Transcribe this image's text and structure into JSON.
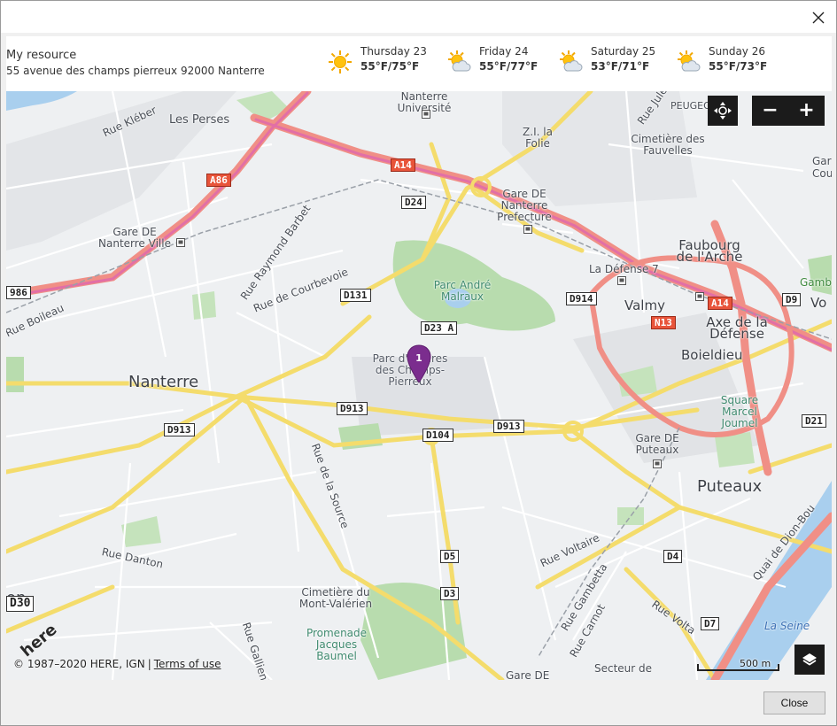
{
  "dialog": {
    "close_icon": "close-x-icon",
    "close_button_label": "Close"
  },
  "resource": {
    "name": "My resource",
    "address": "55 avenue des champs pierreux 92000 Nanterre"
  },
  "weather": [
    {
      "day": "Thursday 23",
      "temp": "55°F/75°F",
      "icon": "sunny-icon"
    },
    {
      "day": "Friday 24",
      "temp": "55°F/77°F",
      "icon": "partly-cloudy-icon"
    },
    {
      "day": "Saturday 25",
      "temp": "53°F/71°F",
      "icon": "partly-cloudy-icon"
    },
    {
      "day": "Sunday 26",
      "temp": "55°F/73°F",
      "icon": "partly-cloudy-icon"
    }
  ],
  "map": {
    "marker_label": "1",
    "controls": {
      "pan_icon": "pan-move-icon",
      "zoom_out": "−",
      "zoom_in": "+",
      "layers_icon": "layers-icon"
    },
    "copyright": "© 1987–2020 HERE, IGN",
    "separator": "|",
    "terms_link": "Terms of use",
    "scale_label": "500 m",
    "logo": "here",
    "places": {
      "nanterre": "Nanterre",
      "puteaux": "Puteaux",
      "faubourg": "Faubourg de l'Arche",
      "axe": "Axe de la Défense",
      "boieldieu": "Boieldieu",
      "valmy": "Valmy",
      "les_perses": "Les Perses",
      "nanterre_univ": "Nanterre Université",
      "zi_folie": "Z.I. la Folie",
      "gare_nanterre_ville": "Gare DE Nanterre Ville",
      "gare_prefecture": "Gare DE Nanterre Prefecture",
      "la_defense": "La Défense 7",
      "cimetiere_fauvelles": "Cimetière des Fauvelles",
      "parc_andre": "Parc André Malraux",
      "parc_affaires": "Parc d'affaires des Champs-Pierreux",
      "square_marcel": "Square Marcel Joumel",
      "gare_puteaux": "Gare DE Puteaux",
      "cimetiere_mont": "Cimetière du Mont-Valérien",
      "promenade": "Promenade Jacques Baumel",
      "secteur": "Secteur de",
      "gare_de_bottom": "Gare DE",
      "peugeot": "PEUGEOT",
      "gam": "Gamb",
      "gar_right": "Gar",
      "cour_right": "Cour",
      "vo_right": "Vo",
      "on_left": "on",
      "la_seine": "La Seine"
    },
    "streets": {
      "kleber": "Rue Kléber",
      "raymond_barbet": "Rue Raymond Barbet",
      "courbevoie": "Rue de Courbevoie",
      "boileau": "Rue Boileau",
      "la_source": "Rue de la Source",
      "danton": "Rue Danton",
      "voltaire": "Rue Voltaire",
      "gambetta": "Rue Gambetta",
      "carnot": "Rue Carnot",
      "volta": "Rue Volta",
      "gallieni": "Rue Gallieni",
      "jules": "Rue Jules",
      "quai": "Quai de Dion-Bou"
    },
    "road_shields": {
      "a86": "A86",
      "a14": "A14",
      "a14b": "A14",
      "d24": "D24",
      "d131": "D131",
      "d23a": "D23 A",
      "d913a": "D913",
      "d913b": "D913",
      "d913c": "D913",
      "d104": "D104",
      "d914": "D914",
      "n13": "N13",
      "d9": "D9",
      "d21": "D21",
      "d5": "D5",
      "d4": "D4",
      "d3": "D3",
      "d7": "D7",
      "n986": "986",
      "d30": "D30"
    }
  }
}
